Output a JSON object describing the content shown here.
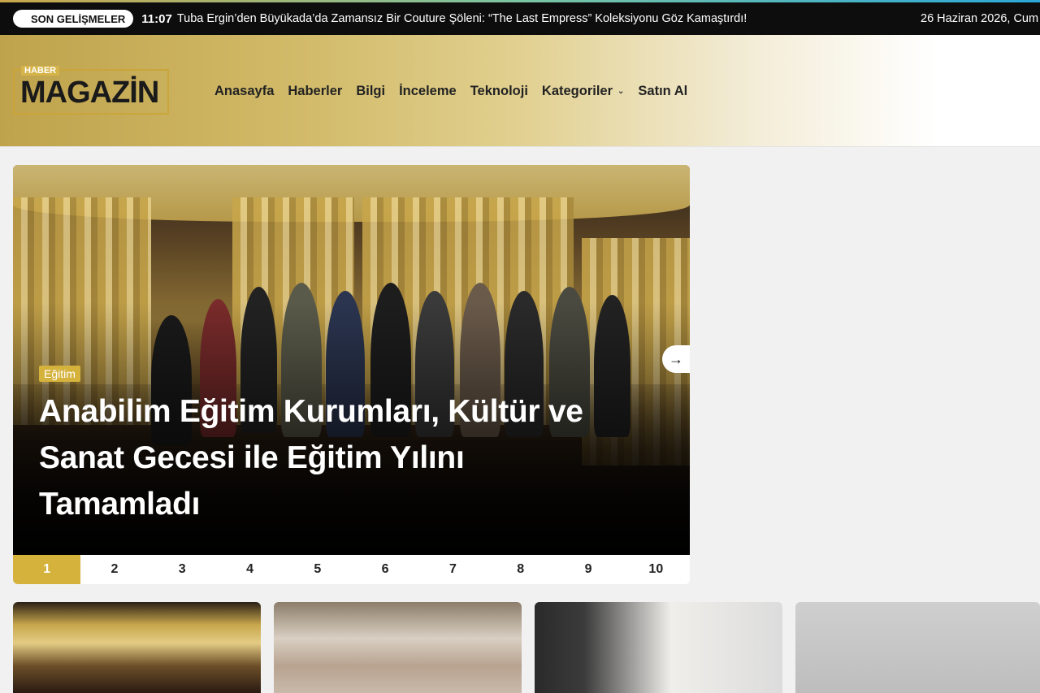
{
  "ticker": {
    "badge": "SON GELİŞMELER",
    "time": "11:07",
    "headline": "Tuba Ergin’den Büyükada’da Zamansız Bir Couture Şöleni: “The Last Empress” Koleksiyonu Göz Kamaştırdı!",
    "date": "26 Haziran 2026, Cum"
  },
  "header": {
    "logo_small": "HABER",
    "logo_big": "MAGAZİN",
    "nav": [
      {
        "label": "Anasayfa"
      },
      {
        "label": "Haberler"
      },
      {
        "label": "Bilgi"
      },
      {
        "label": "İnceleme"
      },
      {
        "label": "Teknoloji"
      },
      {
        "label": "Kategoriler"
      },
      {
        "label": "Satın Al"
      }
    ]
  },
  "slider": {
    "category": "Eğitim",
    "title": "Anabilim Eğitim Kurumları, Kültür ve Sanat Gecesi ile Eğitim Yılını Tamamladı",
    "active_page": "1",
    "pages": [
      "1",
      "2",
      "3",
      "4",
      "5",
      "6",
      "7",
      "8",
      "9",
      "10"
    ]
  },
  "colors": {
    "accent": "#d4b23c",
    "ticker_bg": "#0d0d0d"
  },
  "icons": {
    "next": "arrow-right-icon",
    "dropdown": "chevron-down-icon"
  }
}
